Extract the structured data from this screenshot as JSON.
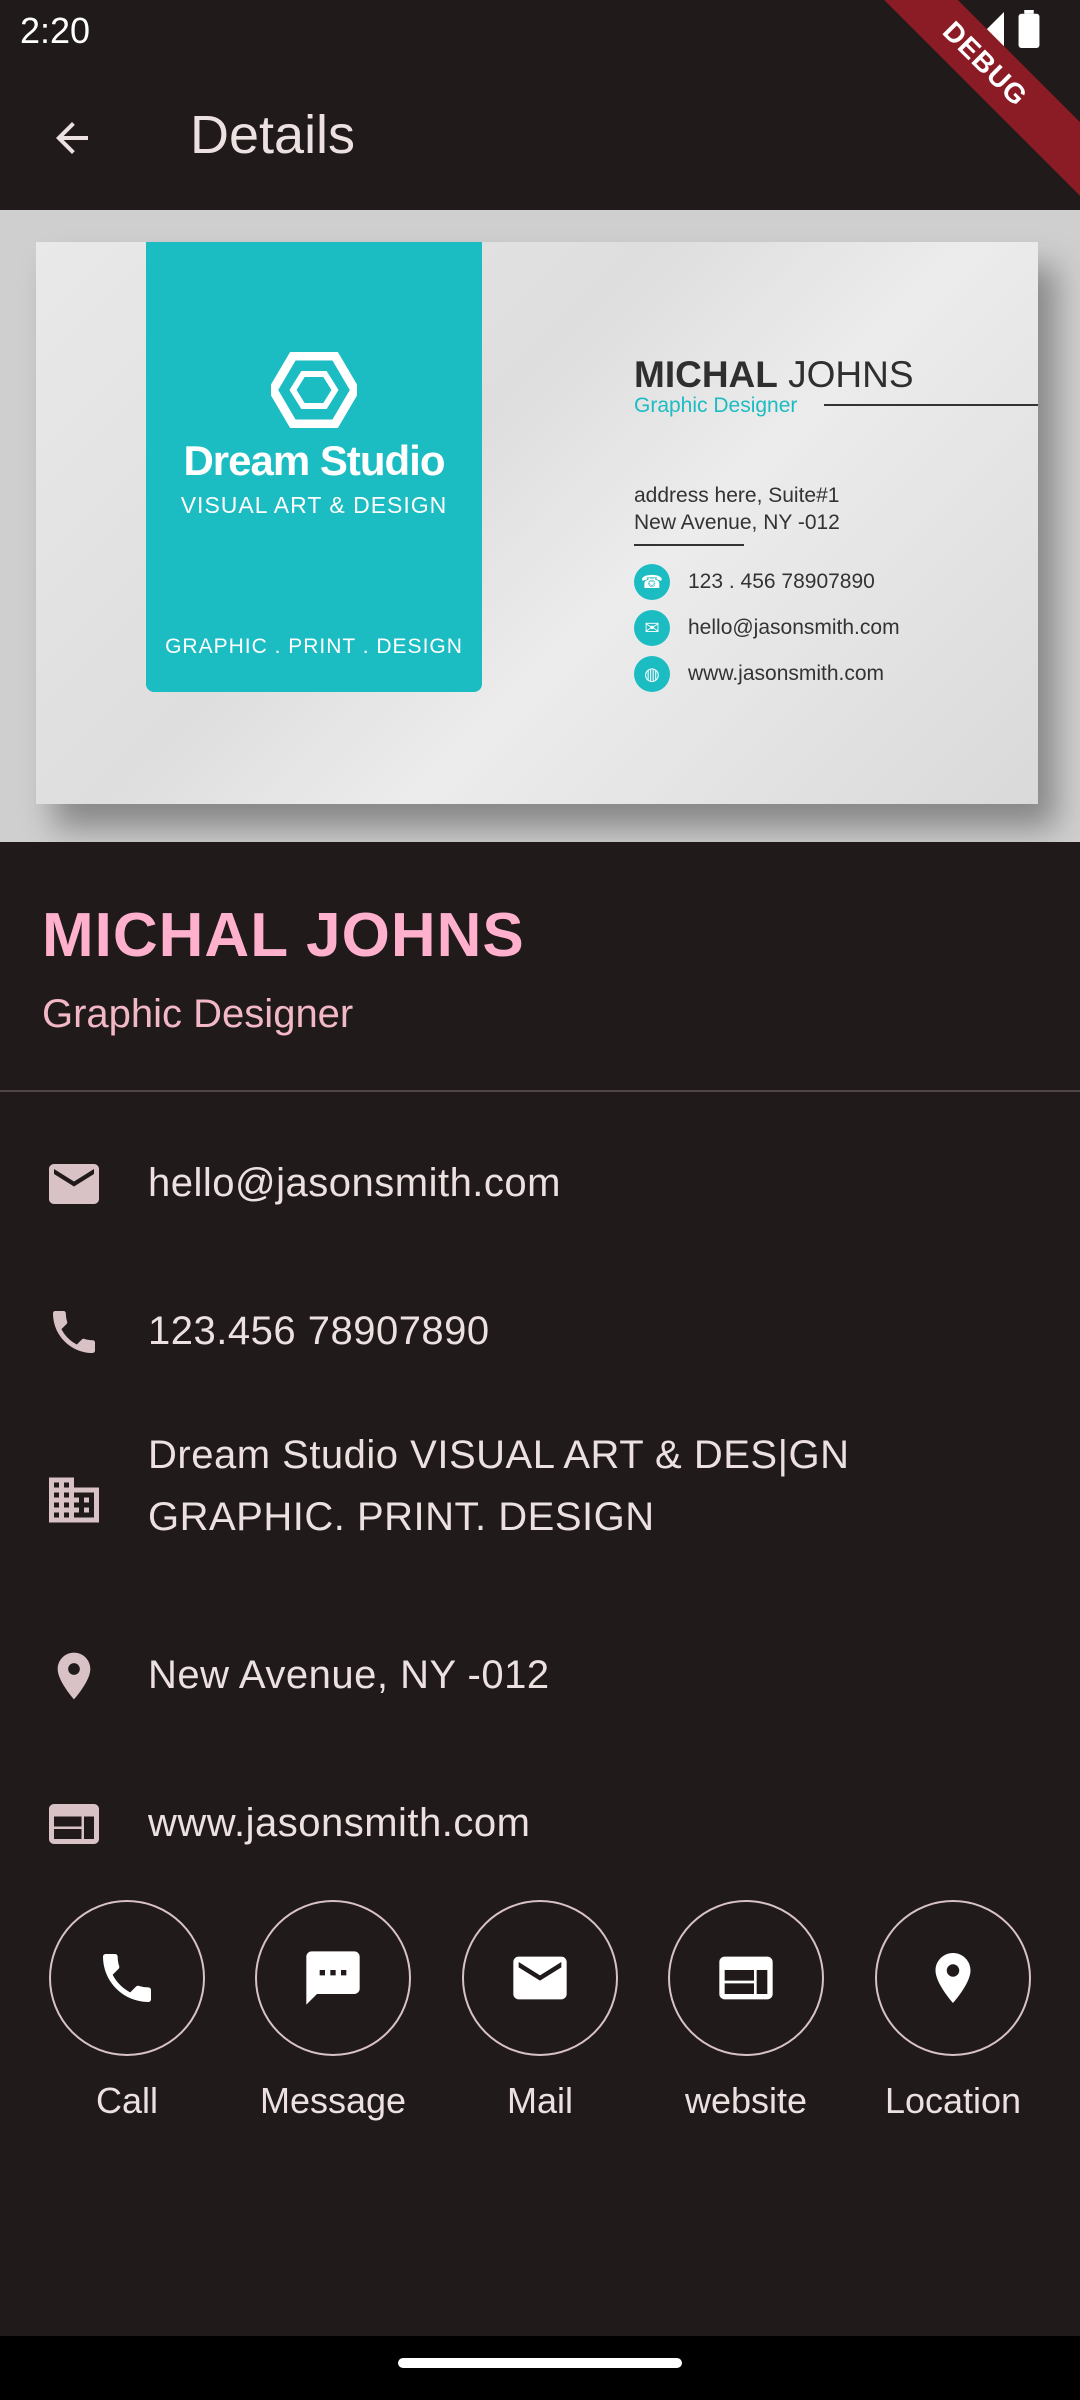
{
  "status": {
    "time": "2:20",
    "debug_label": "DEBUG"
  },
  "app_bar": {
    "title": "Details",
    "back_icon": "arrow-back-icon"
  },
  "card_image": {
    "brand_name": "Dream Studio",
    "brand_subtitle": "VISUAL ART & DESIGN",
    "brand_tagline": "GRAPHIC . PRINT . DESIGN",
    "name_first": "MICHAL",
    "name_last": "JOHNS",
    "role": "Graphic Designer",
    "address_line1": "address here, Suite#1",
    "address_line2": "New Avenue, NY -012",
    "phone": "123 . 456  78907890",
    "email": "hello@jasonsmith.com",
    "website": "www.jasonsmith.com",
    "accent_color": "#1cbcc3"
  },
  "profile": {
    "name": "MICHAL JOHNS",
    "title": "Graphic Designer",
    "name_color": "#ffb0cc"
  },
  "details": [
    {
      "icon": "mail-icon",
      "text": "hello@jasonsmith.com"
    },
    {
      "icon": "phone-icon",
      "text": "123.456 78907890"
    },
    {
      "icon": "business-icon",
      "text_line1": "Dream Studio VISUAL ART & DES|GN",
      "text_line2": "GRAPHIC. PRINT. DESIGN"
    },
    {
      "icon": "location-pin-icon",
      "text": "New Avenue, NY -012"
    },
    {
      "icon": "web-icon",
      "text": "www.jasonsmith.com"
    }
  ],
  "actions": [
    {
      "icon": "phone-icon",
      "label": "Call"
    },
    {
      "icon": "message-icon",
      "label": "Message"
    },
    {
      "icon": "mail-icon",
      "label": "Mail"
    },
    {
      "icon": "web-icon",
      "label": "website"
    },
    {
      "icon": "location-pin-icon",
      "label": "Location"
    }
  ]
}
